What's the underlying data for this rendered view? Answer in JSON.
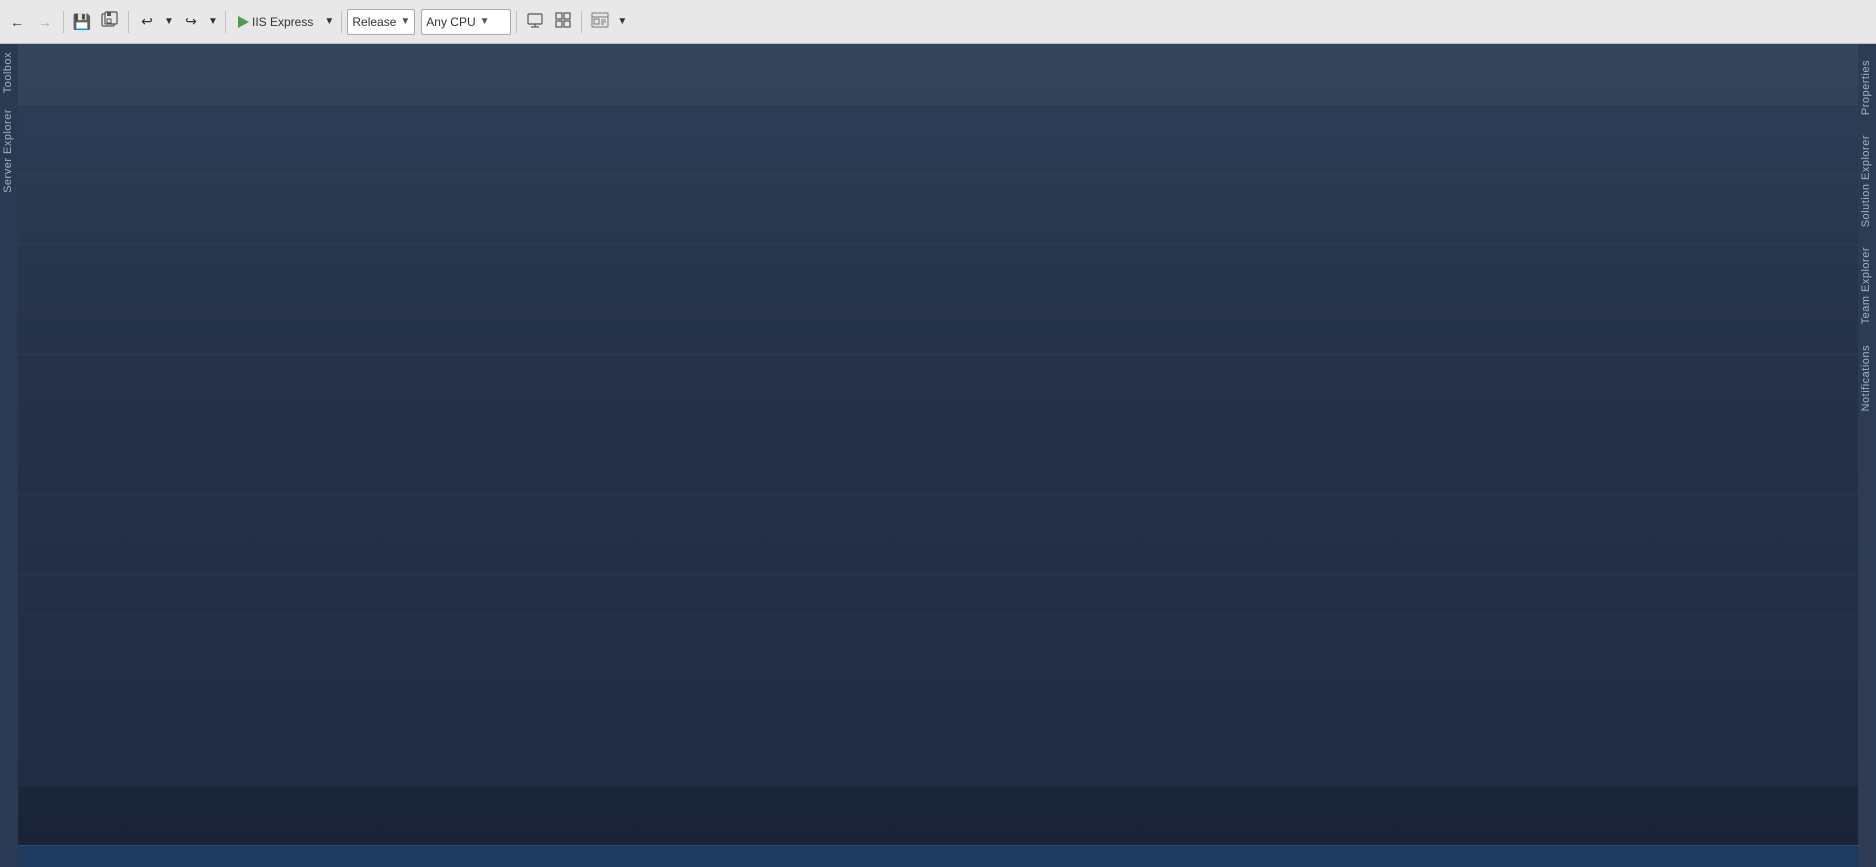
{
  "toolbar": {
    "back_label": "←",
    "forward_label": "→",
    "undo_label": "↩",
    "redo_label": "↪",
    "save_label": "💾",
    "save_all_label": "🗂",
    "run_label": "IIS Express",
    "run_dropdown_arrow": "▾",
    "configuration_label": "Release",
    "configuration_dropdown_arrow": "▾",
    "platform_label": "Any CPU",
    "platform_dropdown_arrow": "▾",
    "attach_label": "⊡",
    "device_label": "⊞",
    "grid_label": "⊟",
    "debug_label": "⊠"
  },
  "left_sidebar": {
    "tabs": [
      "Toolbox",
      "Server Explorer"
    ]
  },
  "right_sidebar": {
    "tabs": [
      "Properties",
      "Solution Explorer",
      "Team Explorer",
      "Notifications"
    ]
  },
  "main": {
    "background_color": "#253348"
  },
  "status_bar": {
    "text": ""
  },
  "bands": [
    60,
    130,
    200,
    310,
    450,
    530,
    570
  ]
}
